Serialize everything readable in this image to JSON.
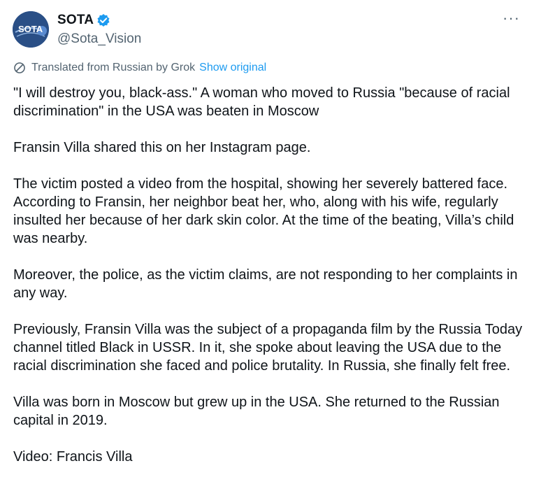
{
  "author": {
    "display_name": "SOTA",
    "handle": "@Sota_Vision",
    "avatar_text": "SOTA"
  },
  "more_icon": "more-horizontal-icon",
  "translation": {
    "label": "Translated from Russian by Grok",
    "show_original": "Show original"
  },
  "paragraphs": [
    "\"I will destroy you, black-ass.\" A woman who moved to Russia \"because of racial discrimination\" in the USA was beaten in Moscow",
    "Fransin Villa shared this on her Instagram page.",
    "The victim posted a video from the hospital, showing her severely battered face. According to Fransin, her neighbor beat her, who, along with his wife, regularly insulted her because of her dark skin color. At the time of the beating, Villa’s child was nearby.",
    "Moreover, the police, as the victim claims, are not responding to her complaints in any way.",
    "Previously, Fransin Villa was the subject of a propaganda film by the Russia Today channel titled Black in USSR. In it, she spoke about leaving the USA due to the racial discrimination she faced and police brutality. In Russia, she finally felt free.",
    "Villa was born in Moscow but grew up in the USA. She returned to the Russian capital in 2019.",
    "Video: Francis Villa"
  ],
  "colors": {
    "verified": "#1d9bf0",
    "link": "#1d9bf0",
    "secondary_text": "#536471",
    "avatar_bg": "#2a4f86"
  }
}
